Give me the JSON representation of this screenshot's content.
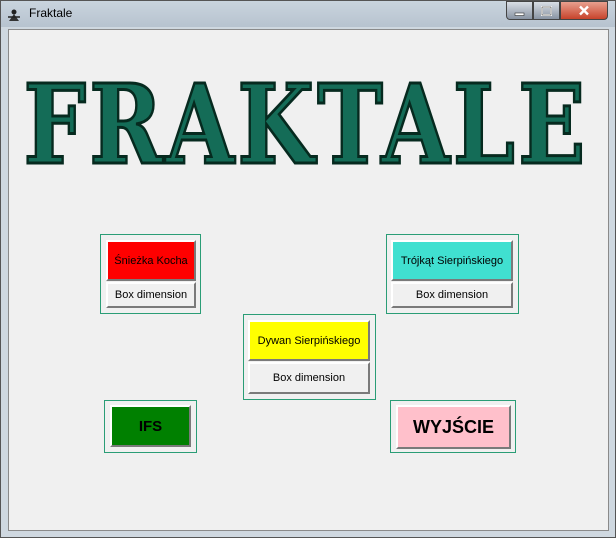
{
  "window": {
    "title": "Fraktale",
    "controls": {
      "minimize": "minimize-icon",
      "maximize": "maximize-icon",
      "close": "close-icon"
    }
  },
  "logo": {
    "text": "Fraktale",
    "fill": "#146c57",
    "stroke": "#062a1f"
  },
  "buttons": {
    "koch": {
      "label": "Śnieżka Kocha",
      "box_label": "Box dimension",
      "color": "#ff0000"
    },
    "triangle": {
      "label": "Trójkąt Sierpińskiego",
      "box_label": "Box dimension",
      "color": "#40e0d0"
    },
    "carpet": {
      "label": "Dywan Sierpińskiego",
      "box_label": "Box dimension",
      "color": "#ffff00"
    },
    "ifs": {
      "label": "IFS",
      "color": "#008000"
    },
    "exit": {
      "label": "WYJŚCIE",
      "color": "#ffc0cb"
    }
  },
  "group_border_color": "#2a9d76"
}
